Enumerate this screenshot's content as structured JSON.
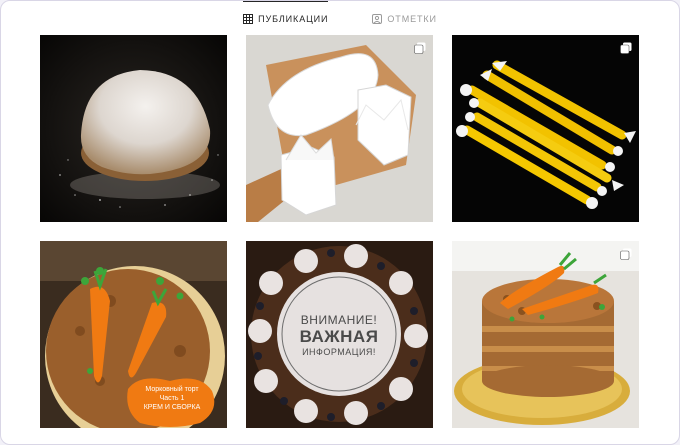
{
  "tabs": [
    {
      "label": "ПУБЛИКАЦИИ",
      "icon": "grid-icon",
      "active": true
    },
    {
      "label": "ОТМЕТКИ",
      "icon": "tagged-user-icon",
      "active": false
    }
  ],
  "posts": [
    {
      "subject": "sugar-dusted-donut",
      "multi": false
    },
    {
      "subject": "paper-tulip-cupcake-liners",
      "multi": true
    },
    {
      "subject": "yellow-modeling-tools",
      "multi": true
    },
    {
      "subject": "carrot-cake",
      "multi": false,
      "overlay": {
        "line1": "Морковный торт",
        "line2": "Часть 1",
        "line3": "КРЕМ И СБОРКА"
      }
    },
    {
      "subject": "chocolate-cake-announcement",
      "multi": false,
      "overlay": {
        "line1": "ВНИМАНИЕ!",
        "line2": "ВАЖНАЯ",
        "line3": "ИНФОРМАЦИЯ!"
      }
    },
    {
      "subject": "carrot-cake-on-gold-board",
      "multi": true
    }
  ],
  "colors": {
    "accent_orange": "#f07a12",
    "tab_active": "#262626",
    "tab_inactive": "#9a9a9a"
  }
}
